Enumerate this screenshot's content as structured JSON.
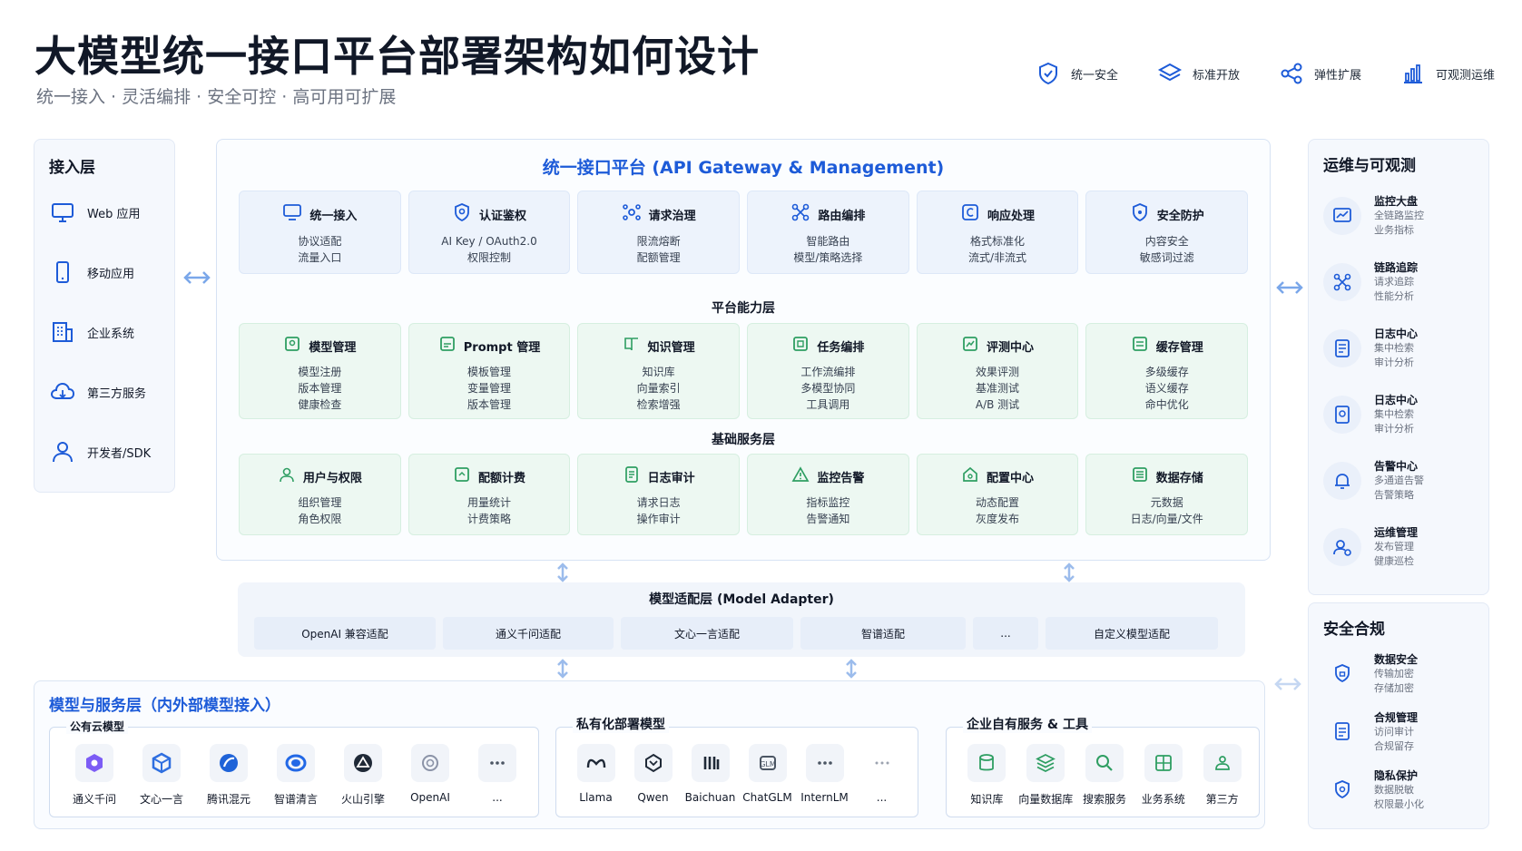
{
  "header": {
    "title": "大模型统一接口平台部署架构如何设计",
    "subtitle": "统一接入 · 灵活编排 · 安全可控 · 高可用可扩展",
    "features": [
      {
        "icon": "shield-check-icon",
        "label": "统一安全"
      },
      {
        "icon": "layers-icon",
        "label": "标准开放"
      },
      {
        "icon": "share-nodes-icon",
        "label": "弹性扩展"
      },
      {
        "icon": "bar-chart-icon",
        "label": "可观测运维"
      }
    ]
  },
  "access_layer": {
    "title": "接入层",
    "items": [
      {
        "icon": "monitor-icon",
        "label": "Web 应用"
      },
      {
        "icon": "mobile-icon",
        "label": "移动应用"
      },
      {
        "icon": "building-icon",
        "label": "企业系统"
      },
      {
        "icon": "cloud-icon",
        "label": "第三方服务"
      },
      {
        "icon": "user-icon",
        "label": "开发者/SDK"
      }
    ]
  },
  "platform": {
    "title": "统一接口平台 (API Gateway & Management)",
    "gateway_cards": [
      {
        "icon": "monitor-icon",
        "title": "统一接入",
        "lines": [
          "协议适配",
          "流量入口"
        ]
      },
      {
        "icon": "shield-user-icon",
        "title": "认证鉴权",
        "lines": [
          "AI Key / OAuth2.0",
          "权限控制"
        ]
      },
      {
        "icon": "hub-icon",
        "title": "请求治理",
        "lines": [
          "限流熔断",
          "配额管理"
        ]
      },
      {
        "icon": "route-icon",
        "title": "路由编排",
        "lines": [
          "智能路由",
          "模型/策略选择"
        ]
      },
      {
        "icon": "response-icon",
        "title": "响应处理",
        "lines": [
          "格式标准化",
          "流式/非流式"
        ]
      },
      {
        "icon": "shield-icon",
        "title": "安全防护",
        "lines": [
          "内容安全",
          "敏感词过滤"
        ]
      }
    ],
    "capability_label": "平台能力层",
    "capability_cards": [
      {
        "icon": "model-icon",
        "title": "模型管理",
        "lines": [
          "模型注册",
          "版本管理",
          "健康检查"
        ]
      },
      {
        "icon": "prompt-icon",
        "title": "Prompt 管理",
        "lines": [
          "模板管理",
          "变量管理",
          "版本管理"
        ]
      },
      {
        "icon": "knowledge-icon",
        "title": "知识管理",
        "lines": [
          "知识库",
          "向量索引",
          "检索增强"
        ]
      },
      {
        "icon": "workflow-icon",
        "title": "任务编排",
        "lines": [
          "工作流编排",
          "多模型协同",
          "工具调用"
        ]
      },
      {
        "icon": "eval-icon",
        "title": "评测中心",
        "lines": [
          "效果评测",
          "基准测试",
          "A/B 测试"
        ]
      },
      {
        "icon": "cache-icon",
        "title": "缓存管理",
        "lines": [
          "多级缓存",
          "语义缓存",
          "命中优化"
        ]
      }
    ],
    "foundation_label": "基础服务层",
    "foundation_cards": [
      {
        "icon": "users-icon",
        "title": "用户与权限",
        "lines": [
          "组织管理",
          "角色权限"
        ]
      },
      {
        "icon": "billing-icon",
        "title": "配额计费",
        "lines": [
          "用量统计",
          "计费策略"
        ]
      },
      {
        "icon": "log-icon",
        "title": "日志审计",
        "lines": [
          "请求日志",
          "操作审计"
        ]
      },
      {
        "icon": "alert-icon",
        "title": "监控告警",
        "lines": [
          "指标监控",
          "告警通知"
        ]
      },
      {
        "icon": "config-icon",
        "title": "配置中心",
        "lines": [
          "动态配置",
          "灰度发布"
        ]
      },
      {
        "icon": "storage-icon",
        "title": "数据存储",
        "lines": [
          "元数据",
          "日志/向量/文件"
        ]
      }
    ]
  },
  "adapter": {
    "title": "模型适配层 (Model Adapter)",
    "items": [
      "OpenAI 兼容适配",
      "通义千问适配",
      "文心一言适配",
      "智谱适配",
      "...",
      "自定义模型适配"
    ]
  },
  "model_service_layer": {
    "title": "模型与服务层（内外部模型接入）",
    "public_cloud": {
      "title": "公有云模型",
      "models": [
        {
          "icon": "tongyi-icon",
          "name": "通义千问"
        },
        {
          "icon": "wenxin-icon",
          "name": "文心一言"
        },
        {
          "icon": "hunyuan-icon",
          "name": "腾讯混元"
        },
        {
          "icon": "zhipu-icon",
          "name": "智谱清言"
        },
        {
          "icon": "volcano-icon",
          "name": "火山引擎"
        },
        {
          "icon": "openai-icon",
          "name": "OpenAI"
        },
        {
          "icon": "more-icon",
          "name": "..."
        }
      ]
    },
    "private": {
      "title": "私有化部署模型",
      "models": [
        {
          "icon": "llama-icon",
          "name": "Llama"
        },
        {
          "icon": "qwen-icon",
          "name": "Qwen"
        },
        {
          "icon": "baichuan-icon",
          "name": "Baichuan"
        },
        {
          "icon": "chatglm-icon",
          "name": "ChatGLM"
        },
        {
          "icon": "more-icon",
          "name": "InternLM"
        },
        {
          "icon": "more-icon",
          "name": "..."
        }
      ]
    },
    "enterprise": {
      "title": "企业自有服务 & 工具",
      "services": [
        {
          "icon": "database-icon",
          "name": "知识库"
        },
        {
          "icon": "vector-db-icon",
          "name": "向量数据库"
        },
        {
          "icon": "search-icon",
          "name": "搜索服务"
        },
        {
          "icon": "grid-icon",
          "name": "业务系统"
        },
        {
          "icon": "third-party-icon",
          "name": "第三方"
        }
      ]
    }
  },
  "ops_panel": {
    "title": "运维与可观测",
    "items": [
      {
        "icon": "dashboard-icon",
        "title": "监控大盘",
        "lines": [
          "全链路监控",
          "业务指标"
        ]
      },
      {
        "icon": "trace-icon",
        "title": "链路追踪",
        "lines": [
          "请求追踪",
          "性能分析"
        ]
      },
      {
        "icon": "log-icon",
        "title": "日志中心",
        "lines": [
          "集中检索",
          "审计分析"
        ]
      },
      {
        "icon": "log-search-icon",
        "title": "日志中心",
        "lines": [
          "集中检索",
          "审计分析"
        ]
      },
      {
        "icon": "bell-icon",
        "title": "告警中心",
        "lines": [
          "多通道告警",
          "告警策略"
        ]
      },
      {
        "icon": "ops-icon",
        "title": "运维管理",
        "lines": [
          "发布管理",
          "健康巡检"
        ]
      }
    ]
  },
  "security_panel": {
    "title": "安全合规",
    "items": [
      {
        "icon": "lock-icon",
        "title": "数据安全",
        "lines": [
          "传输加密",
          "存储加密"
        ]
      },
      {
        "icon": "doc-icon",
        "title": "合规管理",
        "lines": [
          "访问审计",
          "合规留存"
        ]
      },
      {
        "icon": "privacy-icon",
        "title": "隐私保护",
        "lines": [
          "数据脱敏",
          "权限最小化"
        ]
      }
    ]
  },
  "colors": {
    "primary": "#1d5bd8",
    "green": "#2e9e62",
    "blue_card": "#edf3fc",
    "green_card": "#edf8f2"
  }
}
